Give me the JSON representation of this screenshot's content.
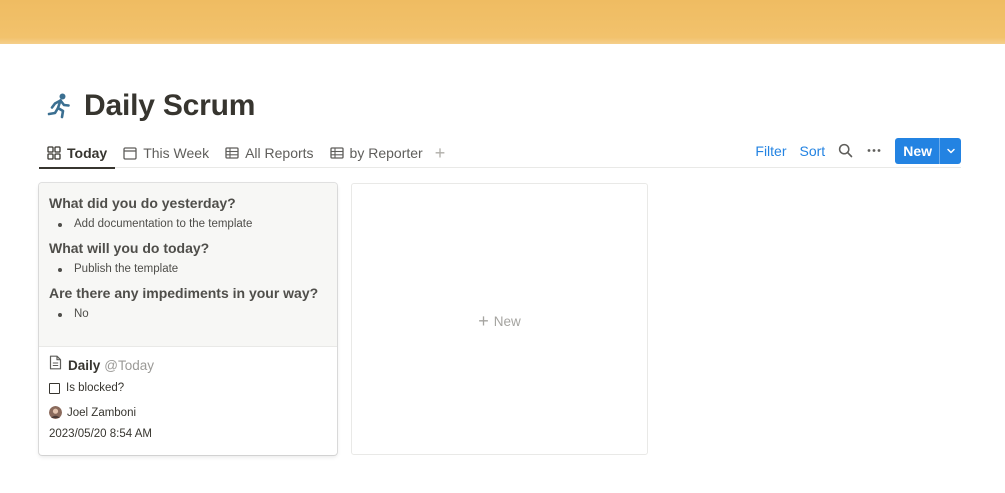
{
  "page": {
    "title": "Daily Scrum",
    "icon": "runner-icon"
  },
  "views": {
    "tabs": [
      {
        "label": "Today",
        "icon": "board-icon",
        "active": true
      },
      {
        "label": "This Week",
        "icon": "calendar-icon",
        "active": false
      },
      {
        "label": "All Reports",
        "icon": "table-icon",
        "active": false
      },
      {
        "label": "by Reporter",
        "icon": "table-icon",
        "active": false
      }
    ],
    "add_view": "+"
  },
  "actions": {
    "filter": "Filter",
    "sort": "Sort",
    "search_icon": "search-icon",
    "more_icon": "more-icon",
    "new": "New",
    "new_menu_icon": "chevron-down-icon"
  },
  "card": {
    "preview": {
      "q1": "What did you do yesterday?",
      "a1": "Add documentation to the template",
      "q2": "What will you do today?",
      "a2": "Publish the template",
      "q3": "Are there any impediments in your way?",
      "a3": "No"
    },
    "title": "Daily",
    "mention": "@Today",
    "blocked_label": "Is blocked?",
    "blocked": false,
    "reporter": "Joel Zamboni",
    "created": "2023/05/20 8:54 AM"
  },
  "empty_group": {
    "new_label": "New"
  },
  "colors": {
    "cover": "#efbc62",
    "accent": "#2383e2",
    "text": "#37352f"
  }
}
